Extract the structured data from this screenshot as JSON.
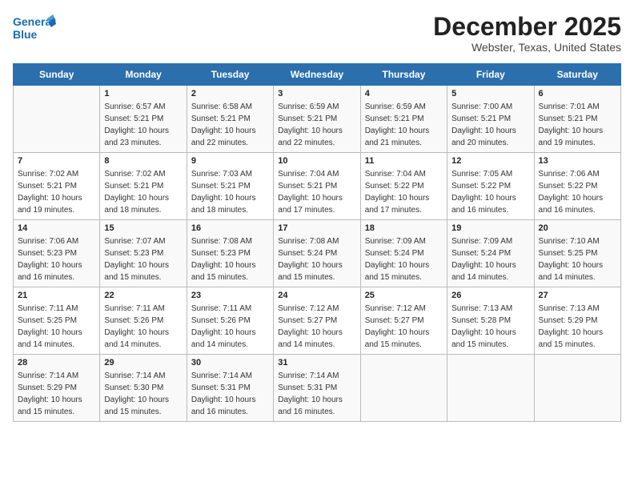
{
  "logo": {
    "line1": "General",
    "line2": "Blue"
  },
  "title": "December 2025",
  "location": "Webster, Texas, United States",
  "days_of_week": [
    "Sunday",
    "Monday",
    "Tuesday",
    "Wednesday",
    "Thursday",
    "Friday",
    "Saturday"
  ],
  "weeks": [
    [
      {
        "day": "",
        "info": ""
      },
      {
        "day": "1",
        "info": "Sunrise: 6:57 AM\nSunset: 5:21 PM\nDaylight: 10 hours\nand 23 minutes."
      },
      {
        "day": "2",
        "info": "Sunrise: 6:58 AM\nSunset: 5:21 PM\nDaylight: 10 hours\nand 22 minutes."
      },
      {
        "day": "3",
        "info": "Sunrise: 6:59 AM\nSunset: 5:21 PM\nDaylight: 10 hours\nand 22 minutes."
      },
      {
        "day": "4",
        "info": "Sunrise: 6:59 AM\nSunset: 5:21 PM\nDaylight: 10 hours\nand 21 minutes."
      },
      {
        "day": "5",
        "info": "Sunrise: 7:00 AM\nSunset: 5:21 PM\nDaylight: 10 hours\nand 20 minutes."
      },
      {
        "day": "6",
        "info": "Sunrise: 7:01 AM\nSunset: 5:21 PM\nDaylight: 10 hours\nand 19 minutes."
      }
    ],
    [
      {
        "day": "7",
        "info": "Sunrise: 7:02 AM\nSunset: 5:21 PM\nDaylight: 10 hours\nand 19 minutes."
      },
      {
        "day": "8",
        "info": "Sunrise: 7:02 AM\nSunset: 5:21 PM\nDaylight: 10 hours\nand 18 minutes."
      },
      {
        "day": "9",
        "info": "Sunrise: 7:03 AM\nSunset: 5:21 PM\nDaylight: 10 hours\nand 18 minutes."
      },
      {
        "day": "10",
        "info": "Sunrise: 7:04 AM\nSunset: 5:21 PM\nDaylight: 10 hours\nand 17 minutes."
      },
      {
        "day": "11",
        "info": "Sunrise: 7:04 AM\nSunset: 5:22 PM\nDaylight: 10 hours\nand 17 minutes."
      },
      {
        "day": "12",
        "info": "Sunrise: 7:05 AM\nSunset: 5:22 PM\nDaylight: 10 hours\nand 16 minutes."
      },
      {
        "day": "13",
        "info": "Sunrise: 7:06 AM\nSunset: 5:22 PM\nDaylight: 10 hours\nand 16 minutes."
      }
    ],
    [
      {
        "day": "14",
        "info": "Sunrise: 7:06 AM\nSunset: 5:23 PM\nDaylight: 10 hours\nand 16 minutes."
      },
      {
        "day": "15",
        "info": "Sunrise: 7:07 AM\nSunset: 5:23 PM\nDaylight: 10 hours\nand 15 minutes."
      },
      {
        "day": "16",
        "info": "Sunrise: 7:08 AM\nSunset: 5:23 PM\nDaylight: 10 hours\nand 15 minutes."
      },
      {
        "day": "17",
        "info": "Sunrise: 7:08 AM\nSunset: 5:24 PM\nDaylight: 10 hours\nand 15 minutes."
      },
      {
        "day": "18",
        "info": "Sunrise: 7:09 AM\nSunset: 5:24 PM\nDaylight: 10 hours\nand 15 minutes."
      },
      {
        "day": "19",
        "info": "Sunrise: 7:09 AM\nSunset: 5:24 PM\nDaylight: 10 hours\nand 14 minutes."
      },
      {
        "day": "20",
        "info": "Sunrise: 7:10 AM\nSunset: 5:25 PM\nDaylight: 10 hours\nand 14 minutes."
      }
    ],
    [
      {
        "day": "21",
        "info": "Sunrise: 7:11 AM\nSunset: 5:25 PM\nDaylight: 10 hours\nand 14 minutes."
      },
      {
        "day": "22",
        "info": "Sunrise: 7:11 AM\nSunset: 5:26 PM\nDaylight: 10 hours\nand 14 minutes."
      },
      {
        "day": "23",
        "info": "Sunrise: 7:11 AM\nSunset: 5:26 PM\nDaylight: 10 hours\nand 14 minutes."
      },
      {
        "day": "24",
        "info": "Sunrise: 7:12 AM\nSunset: 5:27 PM\nDaylight: 10 hours\nand 14 minutes."
      },
      {
        "day": "25",
        "info": "Sunrise: 7:12 AM\nSunset: 5:27 PM\nDaylight: 10 hours\nand 15 minutes."
      },
      {
        "day": "26",
        "info": "Sunrise: 7:13 AM\nSunset: 5:28 PM\nDaylight: 10 hours\nand 15 minutes."
      },
      {
        "day": "27",
        "info": "Sunrise: 7:13 AM\nSunset: 5:29 PM\nDaylight: 10 hours\nand 15 minutes."
      }
    ],
    [
      {
        "day": "28",
        "info": "Sunrise: 7:14 AM\nSunset: 5:29 PM\nDaylight: 10 hours\nand 15 minutes."
      },
      {
        "day": "29",
        "info": "Sunrise: 7:14 AM\nSunset: 5:30 PM\nDaylight: 10 hours\nand 15 minutes."
      },
      {
        "day": "30",
        "info": "Sunrise: 7:14 AM\nSunset: 5:31 PM\nDaylight: 10 hours\nand 16 minutes."
      },
      {
        "day": "31",
        "info": "Sunrise: 7:14 AM\nSunset: 5:31 PM\nDaylight: 10 hours\nand 16 minutes."
      },
      {
        "day": "",
        "info": ""
      },
      {
        "day": "",
        "info": ""
      },
      {
        "day": "",
        "info": ""
      }
    ]
  ]
}
